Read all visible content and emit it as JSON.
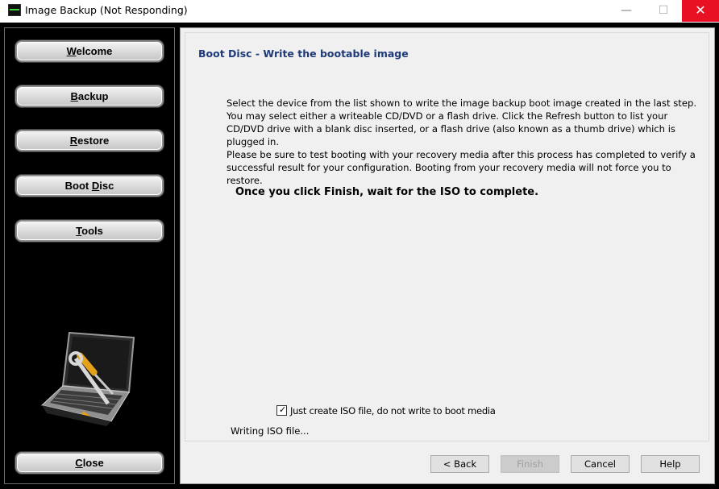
{
  "window": {
    "title": "Image Backup (Not Responding)",
    "controls": {
      "minimize": "—",
      "maximize": "☐",
      "close": "✕"
    }
  },
  "sidebar": {
    "items": [
      {
        "id": "welcome",
        "pre": "",
        "u": "W",
        "post": "elcome"
      },
      {
        "id": "backup",
        "pre": "",
        "u": "B",
        "post": "ackup"
      },
      {
        "id": "restore",
        "pre": "",
        "u": "R",
        "post": "estore"
      },
      {
        "id": "boot-disc",
        "pre": "Boot ",
        "u": "D",
        "post": "isc"
      },
      {
        "id": "tools",
        "pre": "",
        "u": "T",
        "post": "ools"
      }
    ],
    "close": {
      "pre": "",
      "u": "C",
      "post": "lose"
    }
  },
  "main": {
    "title": "Boot Disc - Write the bootable image",
    "para1": "Select the device from the list shown to write the image backup boot image created in the last step. You may select either a writeable CD/DVD or a flash drive. Click the Refresh button to list your CD/DVD drive with a blank disc inserted, or a flash drive (also known as a thumb drive) which is plugged in.",
    "para2": "Please be sure to test booting with your recovery media after this process has completed to verify a successful result for your configuration. Booting from your recovery media will not force you to restore.",
    "note": "Once you click Finish, wait for the ISO to complete.",
    "iso_checkbox": {
      "label": "Just create ISO file, do not write to boot media",
      "checked": true
    },
    "status": "Writing ISO file..."
  },
  "buttons": {
    "back": "< Back",
    "finish": "Finish",
    "cancel": "Cancel",
    "help": "Help"
  },
  "colors": {
    "title_accent": "#1f3a78",
    "close_red": "#e81123",
    "sidebar_bg": "#000000"
  }
}
